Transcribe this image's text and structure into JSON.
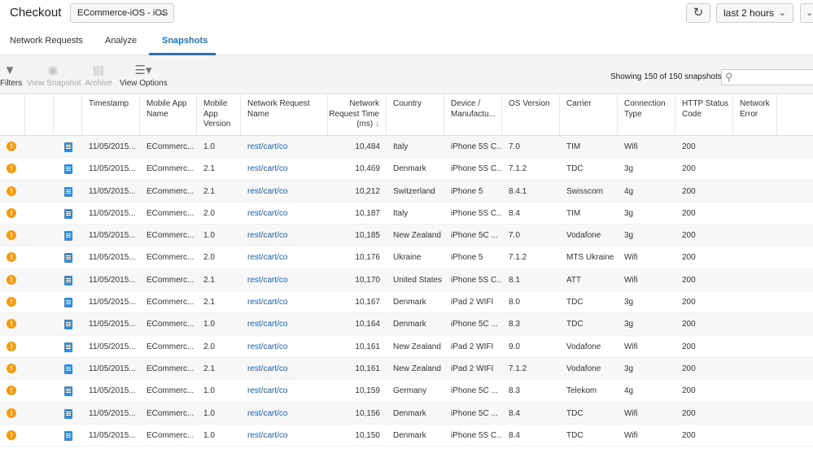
{
  "header": {
    "title": "Checkout",
    "app_selector": "ECommerce-iOS - iOS",
    "time_range": "last 2 hours"
  },
  "tabs": [
    {
      "label": "Network Requests",
      "active": false
    },
    {
      "label": "Analyze",
      "active": false
    },
    {
      "label": "Snapshots",
      "active": true
    }
  ],
  "toolbar": {
    "filters": "Filters",
    "view_snapshot": "View Snapshot",
    "archive": "Archive",
    "view_options": "View Options",
    "showing": "Showing 150 of 150 snapshots.",
    "search_placeholder": ""
  },
  "table": {
    "columns": [
      "Timestamp",
      "Mobile App Name",
      "Mobile App Version",
      "Network Request Name",
      "Network Request Time (ms)",
      "Country",
      "Device / Manufactu...",
      "OS Version",
      "Carrier",
      "Connection Type",
      "HTTP Status Code",
      "Network Error"
    ],
    "rows": [
      [
        "11/05/2015...",
        "ECommerc...",
        "1.0",
        "rest/cart/co",
        "10,484",
        "Italy",
        "iPhone 5S C...",
        "7.0",
        "TIM",
        "Wifi",
        "200",
        ""
      ],
      [
        "11/05/2015...",
        "ECommerc...",
        "2.1",
        "rest/cart/co",
        "10,469",
        "Denmark",
        "iPhone 5S C...",
        "7.1.2",
        "TDC",
        "3g",
        "200",
        ""
      ],
      [
        "11/05/2015...",
        "ECommerc...",
        "2.1",
        "rest/cart/co",
        "10,212",
        "Switzerland",
        "iPhone 5",
        "8.4.1",
        "Swisscom",
        "4g",
        "200",
        ""
      ],
      [
        "11/05/2015...",
        "ECommerc...",
        "2.0",
        "rest/cart/co",
        "10,187",
        "Italy",
        "iPhone 5S C...",
        "8.4",
        "TIM",
        "3g",
        "200",
        ""
      ],
      [
        "11/05/2015...",
        "ECommerc...",
        "1.0",
        "rest/cart/co",
        "10,185",
        "New Zealand",
        "iPhone 5C ...",
        "7.0",
        "Vodafone",
        "3g",
        "200",
        ""
      ],
      [
        "11/05/2015...",
        "ECommerc...",
        "2.0",
        "rest/cart/co",
        "10,176",
        "Ukraine",
        "iPhone 5",
        "7.1.2",
        "MTS Ukraine",
        "Wifi",
        "200",
        ""
      ],
      [
        "11/05/2015...",
        "ECommerc...",
        "2.1",
        "rest/cart/co",
        "10,170",
        "United States",
        "iPhone 5S C...",
        "8.1",
        "ATT",
        "Wifi",
        "200",
        ""
      ],
      [
        "11/05/2015...",
        "ECommerc...",
        "2.1",
        "rest/cart/co",
        "10,167",
        "Denmark",
        "iPad 2 WIFI",
        "8.0",
        "TDC",
        "3g",
        "200",
        ""
      ],
      [
        "11/05/2015...",
        "ECommerc...",
        "1.0",
        "rest/cart/co",
        "10,164",
        "Denmark",
        "iPhone 5C ...",
        "8.3",
        "TDC",
        "3g",
        "200",
        ""
      ],
      [
        "11/05/2015...",
        "ECommerc...",
        "2.0",
        "rest/cart/co",
        "10,161",
        "New Zealand",
        "iPad 2 WIFI",
        "9.0",
        "Vodafone",
        "Wifi",
        "200",
        ""
      ],
      [
        "11/05/2015...",
        "ECommerc...",
        "2.1",
        "rest/cart/co",
        "10,161",
        "New Zealand",
        "iPad 2 WIFI",
        "7.1.2",
        "Vodafone",
        "3g",
        "200",
        ""
      ],
      [
        "11/05/2015...",
        "ECommerc...",
        "1.0",
        "rest/cart/co",
        "10,159",
        "Germany",
        "iPhone 5C ...",
        "8.3",
        "Telekom",
        "4g",
        "200",
        ""
      ],
      [
        "11/05/2015...",
        "ECommerc...",
        "1.0",
        "rest/cart/co",
        "10,156",
        "Denmark",
        "iPhone 5C ...",
        "8.4",
        "TDC",
        "Wifi",
        "200",
        ""
      ],
      [
        "11/05/2015...",
        "ECommerc...",
        "1.0",
        "rest/cart/co",
        "10,150",
        "Denmark",
        "iPhone 5S C...",
        "8.4",
        "TDC",
        "Wifi",
        "200",
        ""
      ]
    ]
  },
  "colors": {
    "accent": "#1a73c8",
    "warning": "#f39c12",
    "link": "#1a5fb4"
  },
  "icons": {
    "warning": "warning-icon",
    "snapshot": "document-icon",
    "filter": "filter-icon",
    "refresh": "refresh-icon",
    "search": "search-icon"
  }
}
